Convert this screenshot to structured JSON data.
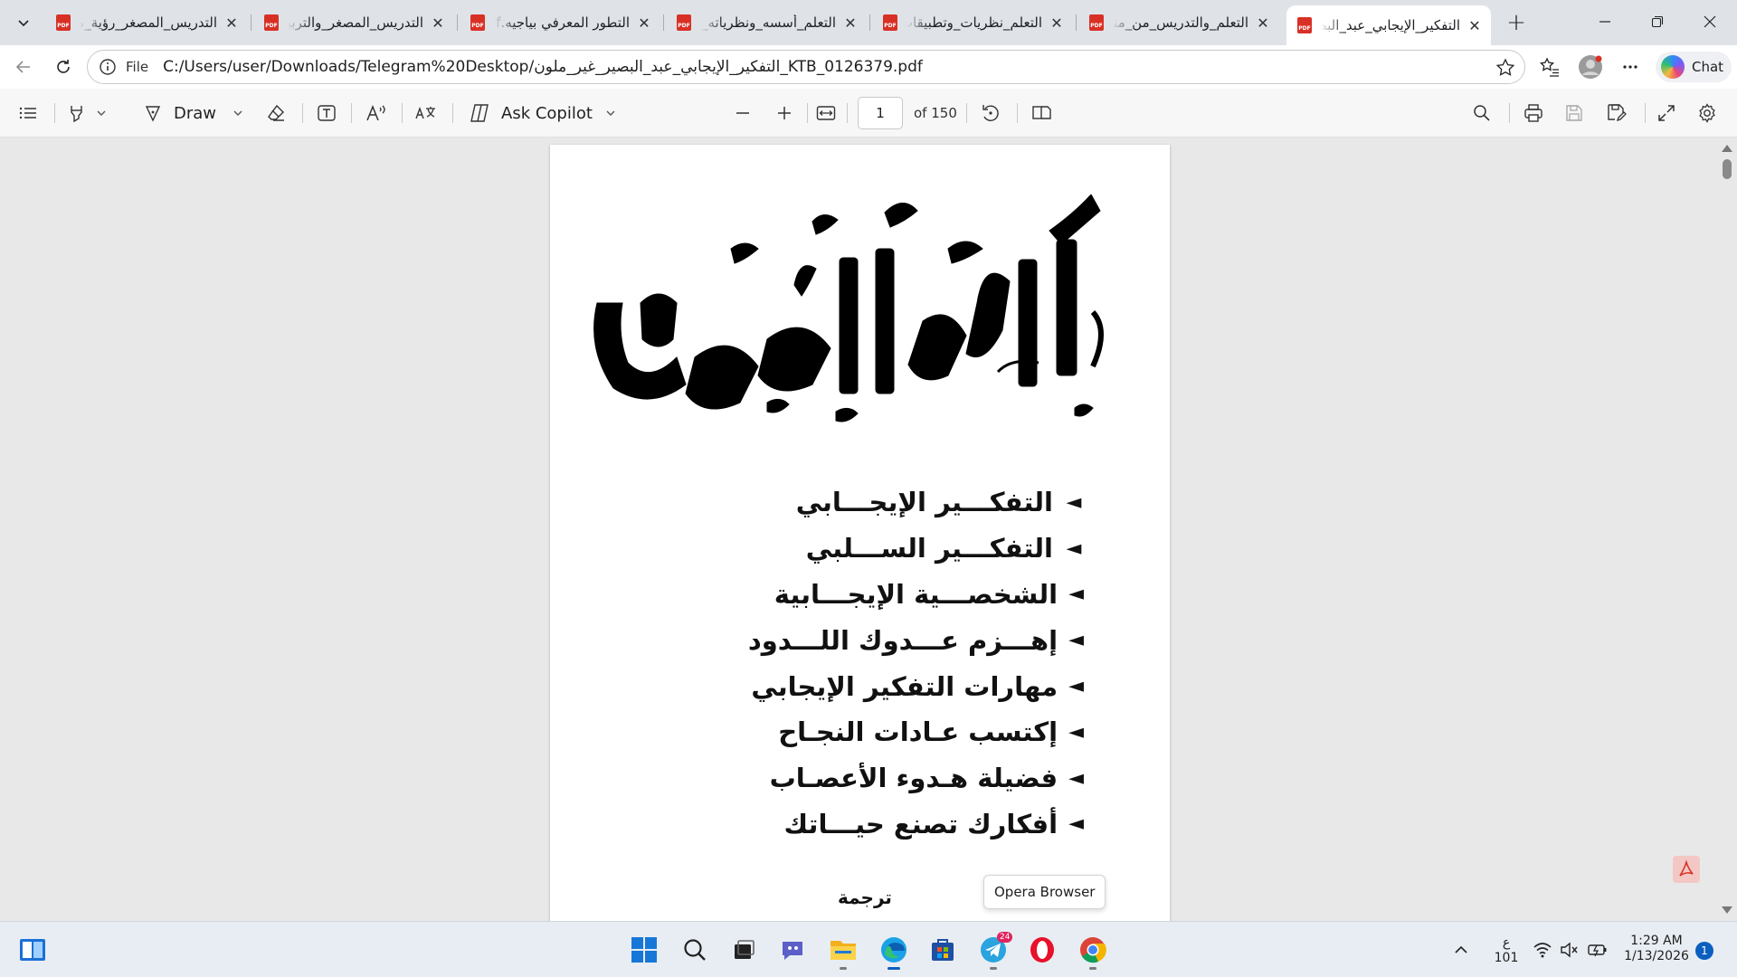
{
  "browser": {
    "tabs": [
      {
        "title": "التدريس_المصغر_رؤية_معاصرة",
        "active": false
      },
      {
        "title": "التدريس_المصغر_والتربية_العملية",
        "active": false
      },
      {
        "title": "التطور المعرفي بياجيه.pdf",
        "active": false
      },
      {
        "title": "التعلم_أسسه_ونظرياته_وتطبيقاته",
        "active": false
      },
      {
        "title": "التعلم_نظريات_وتطبيقات",
        "active": false
      },
      {
        "title": "التعلم_والتدريس_من_منظور",
        "active": false
      },
      {
        "title": "التفكير_الإيجابي_عبد_البصير",
        "active": true
      }
    ],
    "address": {
      "scheme": "File",
      "url": "C:/Users/user/Downloads/Telegram%20Desktop/التفكير_الإيجابي_عبد_البصير_غير_ملون_KTB_0126379.pdf"
    },
    "chat_label": "Chat"
  },
  "pdf_toolbar": {
    "draw_label": "Draw",
    "copilot_label": "Ask Copilot",
    "current_page": "1",
    "page_total": "of 150"
  },
  "document": {
    "title": "التفكير الإيجابي",
    "contents": [
      "التفكـــير الإيجـــابي",
      "التفكـــير الســـلبي",
      "الشخصـــية الإيجـــابية",
      "إهـــزم عـــدوك اللـــدود",
      "مهارات التفكير الإيجابي",
      "إكتسب عـادات النجـاح",
      "فضيلة هـدوء الأعصـاب",
      "أفكارك تصنع حيـــاتك"
    ],
    "translation_label": "ترجمة"
  },
  "tooltip": "Opera Browser",
  "taskbar": {
    "telegram_badge": "24",
    "lang_top": "ع",
    "lang_bottom": "101",
    "time": "1:29 AM",
    "date": "1/13/2026",
    "notification_count": "1"
  }
}
